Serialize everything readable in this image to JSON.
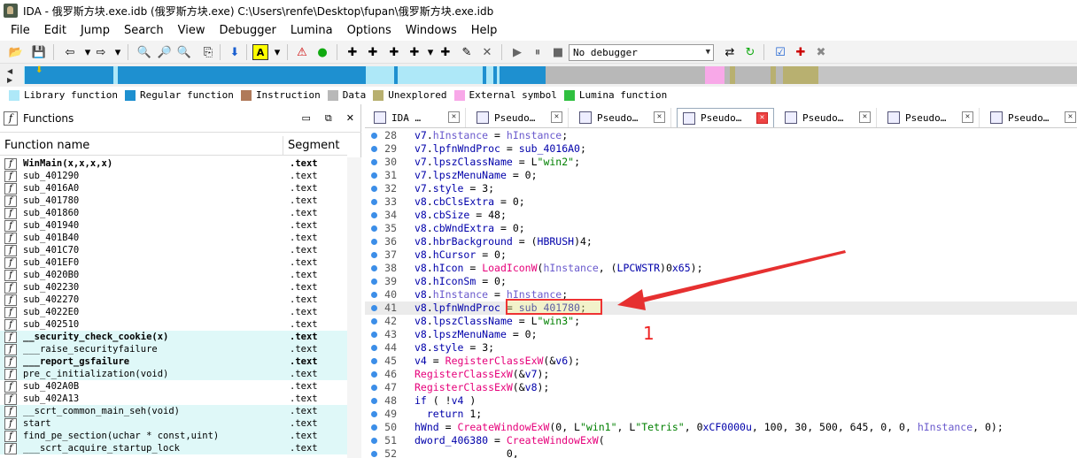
{
  "title": "IDA - 俄罗斯方块.exe.idb (俄罗斯方块.exe) C:\\Users\\renfe\\Desktop\\fupan\\俄罗斯方块.exe.idb",
  "menu": [
    "File",
    "Edit",
    "Jump",
    "Search",
    "View",
    "Debugger",
    "Lumina",
    "Options",
    "Windows",
    "Help"
  ],
  "toolbar": {
    "debugger": "No debugger"
  },
  "legend": [
    {
      "label": "Library function",
      "color": "#aee8f8"
    },
    {
      "label": "Regular function",
      "color": "#1e90d0"
    },
    {
      "label": "Instruction",
      "color": "#b07a5a"
    },
    {
      "label": "Data",
      "color": "#b8b8b8"
    },
    {
      "label": "Unexplored",
      "color": "#b8b070"
    },
    {
      "label": "External symbol",
      "color": "#f8a8e8"
    },
    {
      "label": "Lumina function",
      "color": "#30c040"
    }
  ],
  "functions_panel": {
    "title": "Functions",
    "col_name": "Function name",
    "col_segment": "Segment",
    "rows": [
      {
        "name": "WinMain(x,x,x,x)",
        "segment": ".text",
        "bold": true,
        "lib": false
      },
      {
        "name": "sub_401290",
        "segment": ".text",
        "bold": false,
        "lib": false
      },
      {
        "name": "sub_4016A0",
        "segment": ".text",
        "bold": false,
        "lib": false
      },
      {
        "name": "sub_401780",
        "segment": ".text",
        "bold": false,
        "lib": false
      },
      {
        "name": "sub_401860",
        "segment": ".text",
        "bold": false,
        "lib": false
      },
      {
        "name": "sub_401940",
        "segment": ".text",
        "bold": false,
        "lib": false
      },
      {
        "name": "sub_401B40",
        "segment": ".text",
        "bold": false,
        "lib": false
      },
      {
        "name": "sub_401C70",
        "segment": ".text",
        "bold": false,
        "lib": false
      },
      {
        "name": "sub_401EF0",
        "segment": ".text",
        "bold": false,
        "lib": false
      },
      {
        "name": "sub_4020B0",
        "segment": ".text",
        "bold": false,
        "lib": false
      },
      {
        "name": "sub_402230",
        "segment": ".text",
        "bold": false,
        "lib": false
      },
      {
        "name": "sub_402270",
        "segment": ".text",
        "bold": false,
        "lib": false
      },
      {
        "name": "sub_4022E0",
        "segment": ".text",
        "bold": false,
        "lib": false
      },
      {
        "name": "sub_402510",
        "segment": ".text",
        "bold": false,
        "lib": false
      },
      {
        "name": "__security_check_cookie(x)",
        "segment": ".text",
        "bold": true,
        "lib": true
      },
      {
        "name": "___raise_securityfailure",
        "segment": ".text",
        "bold": false,
        "lib": true
      },
      {
        "name": "___report_gsfailure",
        "segment": ".text",
        "bold": true,
        "lib": true
      },
      {
        "name": "pre_c_initialization(void)",
        "segment": ".text",
        "bold": false,
        "lib": true
      },
      {
        "name": "sub_402A0B",
        "segment": ".text",
        "bold": false,
        "lib": false
      },
      {
        "name": "sub_402A13",
        "segment": ".text",
        "bold": false,
        "lib": false
      },
      {
        "name": "__scrt_common_main_seh(void)",
        "segment": ".text",
        "bold": false,
        "lib": true
      },
      {
        "name": "start",
        "segment": ".text",
        "bold": false,
        "lib": true
      },
      {
        "name": "find_pe_section(uchar * const,uint)",
        "segment": ".text",
        "bold": false,
        "lib": true
      },
      {
        "name": "___scrt_acquire_startup_lock",
        "segment": ".text",
        "bold": false,
        "lib": true
      }
    ]
  },
  "tabs": [
    {
      "label": "IDA …",
      "active": false
    },
    {
      "label": "Pseudo…",
      "active": false
    },
    {
      "label": "Pseudo…",
      "active": false
    },
    {
      "label": "Pseudo…",
      "active": true
    },
    {
      "label": "Pseudo…",
      "active": false
    },
    {
      "label": "Pseudo…",
      "active": false
    },
    {
      "label": "Pseudo…",
      "active": false
    }
  ],
  "code_lines": [
    {
      "n": "28",
      "t": "v7.hInstance = hInstance;"
    },
    {
      "n": "29",
      "t": "v7.lpfnWndProc = sub_4016A0;"
    },
    {
      "n": "30",
      "t": "v7.lpszClassName = L\"win2\";"
    },
    {
      "n": "31",
      "t": "v7.lpszMenuName = 0;"
    },
    {
      "n": "32",
      "t": "v7.style = 3;"
    },
    {
      "n": "33",
      "t": "v8.cbClsExtra = 0;"
    },
    {
      "n": "34",
      "t": "v8.cbSize = 48;"
    },
    {
      "n": "35",
      "t": "v8.cbWndExtra = 0;"
    },
    {
      "n": "36",
      "t": "v8.hbrBackground = (HBRUSH)4;"
    },
    {
      "n": "37",
      "t": "v8.hCursor = 0;"
    },
    {
      "n": "38",
      "t": "v8.hIcon = LoadIconW(hInstance, (LPCWSTR)0x65);"
    },
    {
      "n": "39",
      "t": "v8.hIconSm = 0;"
    },
    {
      "n": "40",
      "t": "v8.hInstance = hInstance;"
    },
    {
      "n": "41",
      "t": "v8.lpfnWndProc = sub_401780;"
    },
    {
      "n": "42",
      "t": "v8.lpszClassName = L\"win3\";"
    },
    {
      "n": "43",
      "t": "v8.lpszMenuName = 0;"
    },
    {
      "n": "44",
      "t": "v8.style = 3;"
    },
    {
      "n": "45",
      "t": "v4 = RegisterClassExW(&v6);"
    },
    {
      "n": "46",
      "t": "RegisterClassExW(&v7);"
    },
    {
      "n": "47",
      "t": "RegisterClassExW(&v8);"
    },
    {
      "n": "48",
      "t": "if ( !v4 )"
    },
    {
      "n": "49",
      "t": "  return 1;"
    },
    {
      "n": "50",
      "t": "hWnd = CreateWindowExW(0, L\"win1\", L\"Tetris\", 0xCF0000u, 100, 30, 500, 645, 0, 0, hInstance, 0);"
    },
    {
      "n": "51",
      "t": "dword_406380 = CreateWindowExW("
    },
    {
      "n": "52",
      "t": "               0,"
    }
  ],
  "annotation": {
    "label": "1"
  }
}
